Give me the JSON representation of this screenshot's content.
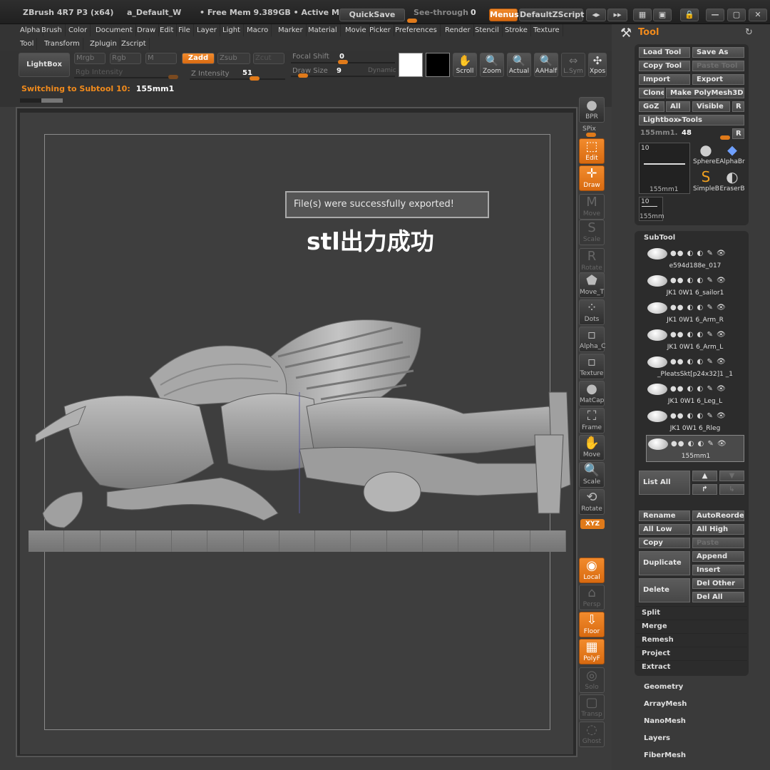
{
  "titlebar": {
    "app_title": "ZBrush 4R7 P3 (x64)",
    "doc_name": "a_Default_W",
    "mem": "• Free Mem 9.389GB • Active Me",
    "quicksave": "QuickSave",
    "see_through_label": "See-through",
    "see_through_value": "0",
    "menus": "Menus",
    "zscript": "DefaultZScript"
  },
  "menubar": {
    "row1": [
      "Alpha",
      "Brush",
      "Color",
      "Document",
      "Draw",
      "Edit",
      "File",
      "Layer",
      "Light",
      "Macro",
      "Marker",
      "Material",
      "Movie",
      "Picker",
      "Preferences",
      "Render",
      "Stencil",
      "Stroke",
      "Texture"
    ],
    "row2": [
      "Tool",
      "Transform",
      "Zplugin",
      "Zscript"
    ]
  },
  "shelf": {
    "lightbox": "LightBox",
    "mrgb": "Mrgb",
    "rgb": "Rgb",
    "m": "M",
    "zadd": "Zadd",
    "zsub": "Zsub",
    "zcut": "Zcut",
    "rgb_intensity": "Rgb Intensity",
    "z_intensity_label": "Z Intensity",
    "z_intensity_value": "51",
    "focal_shift_label": "Focal Shift",
    "focal_shift_value": "0",
    "draw_size_label": "Draw Size",
    "draw_size_value": "9",
    "dynamic": "Dynamic",
    "scroll": "Scroll",
    "zoom": "Zoom",
    "actual": "Actual",
    "aahalf": "AAHalf",
    "lsym": "L.Sym",
    "xpose": "Xpos"
  },
  "status": {
    "message": "Switching to Subtool 10:",
    "value": "155mm1"
  },
  "viewport": {
    "toast": "File(s) were successfully exported!",
    "caption": "stl出力成功"
  },
  "right_toolbar": [
    {
      "label": "BPR",
      "icon": "bpr-icon",
      "state": "normal"
    },
    {
      "label": "Edit",
      "icon": "edit-icon",
      "state": "orange"
    },
    {
      "label": "Draw",
      "icon": "draw-icon",
      "state": "orange"
    },
    {
      "label": "Move",
      "icon": "move-mode-icon",
      "state": "dim"
    },
    {
      "label": "Scale",
      "icon": "scale-mode-icon",
      "state": "dim"
    },
    {
      "label": "Rotate",
      "icon": "rotate-mode-icon",
      "state": "dim"
    },
    {
      "label": "Move_T",
      "icon": "movetopological-icon",
      "state": "normal"
    },
    {
      "label": "Dots",
      "icon": "dots-icon",
      "state": "normal"
    },
    {
      "label": "Alpha_C",
      "icon": "alpha-icon",
      "state": "normal"
    },
    {
      "label": "Texture",
      "icon": "texture-icon",
      "state": "normal"
    },
    {
      "label": "MatCap",
      "icon": "matcap-icon",
      "state": "normal"
    },
    {
      "label": "Frame",
      "icon": "frame-icon",
      "state": "normal"
    },
    {
      "label": "Move",
      "icon": "move-icon",
      "state": "normal"
    },
    {
      "label": "Scale",
      "icon": "scale-icon",
      "state": "normal"
    },
    {
      "label": "Rotate",
      "icon": "rotate-icon",
      "state": "normal"
    },
    {
      "label": "Local",
      "icon": "local-icon",
      "state": "orange"
    },
    {
      "label": "Persp",
      "icon": "persp-icon",
      "state": "dim"
    },
    {
      "label": "Floor",
      "icon": "floor-icon",
      "state": "orange"
    },
    {
      "label": "PolyF",
      "icon": "polyframe-icon",
      "state": "orange"
    },
    {
      "label": "Solo",
      "icon": "solo-icon",
      "state": "dim"
    },
    {
      "label": "Transp",
      "icon": "transp-icon",
      "state": "dim"
    },
    {
      "label": "Ghost",
      "icon": "ghost-icon",
      "state": "dim"
    }
  ],
  "right_extra": {
    "spix": "SPix",
    "xyz": "XYZ"
  },
  "tool_panel": {
    "title": "Tool",
    "load_tool": "Load Tool",
    "save_as": "Save As",
    "copy_tool": "Copy Tool",
    "paste_tool": "Paste Tool",
    "import": "Import",
    "export": "Export",
    "clone": "Clone",
    "make_polymesh": "Make PolyMesh3D",
    "goz": "GoZ",
    "all": "All",
    "visible": "Visible",
    "r": "R",
    "lightbox_tools": "Lightbox▸Tools",
    "current_tool_label": "155mm1.",
    "current_tool_value": "48",
    "thumb_big_num": "10",
    "thumb_big_name": "155mm1",
    "thumb_small_num": "10",
    "thumb_small_name": "155mm",
    "tools": [
      {
        "name": "SphereE",
        "icon": "sphere-tool-icon"
      },
      {
        "name": "AlphaBr",
        "icon": "alphabrush-tool-icon"
      },
      {
        "name": "SimpleB",
        "icon": "simplebrush-tool-icon"
      },
      {
        "name": "EraserB",
        "icon": "eraserbrush-tool-icon"
      }
    ]
  },
  "subtool": {
    "header": "SubTool",
    "items": [
      "e594d188e_017",
      "JK1 0W1 6_sailor1",
      "JK1 0W1 6_Arm_R",
      "JK1 0W1 6_Arm_L",
      "_PleatsSkt[p24x32]1 _1",
      "JK1 0W1 6_Leg_L",
      "JK1 0W1 6_Rleg",
      "155mm1"
    ],
    "list_all": "List All",
    "rename": "Rename",
    "autoreorder": "AutoReorder",
    "all_low": "All Low",
    "all_high": "All High",
    "copy": "Copy",
    "paste": "Paste",
    "duplicate": "Duplicate",
    "append": "Append",
    "insert": "Insert",
    "delete": "Delete",
    "del_other": "Del Other",
    "del_all": "Del All",
    "split": "Split",
    "merge": "Merge",
    "remesh": "Remesh",
    "project": "Project",
    "extract": "Extract"
  },
  "tool_sections": [
    "Geometry",
    "ArrayMesh",
    "NanoMesh",
    "Layers",
    "FiberMesh"
  ]
}
